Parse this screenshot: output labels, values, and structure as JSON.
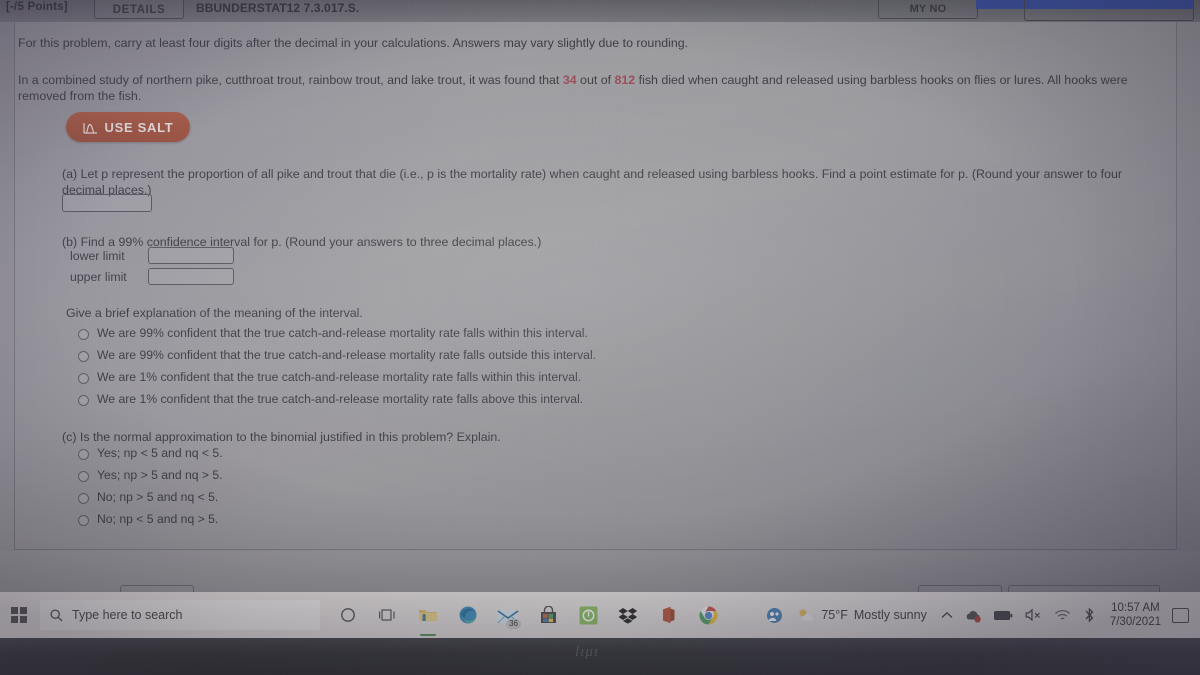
{
  "question_header": {
    "points": "[-/5 Points]",
    "details_button": "DETAILS",
    "title": "BBUNDERSTAT12 7.3.017.S.",
    "my_notes_button": "MY NO"
  },
  "content": {
    "note": "For this problem, carry at least four digits after the decimal in your calculations. Answers may vary slightly due to rounding.",
    "problem_pre": "In a combined study of northern pike, cutthroat trout, rainbow trout, and lake trout, it was found that ",
    "problem_num1": "34",
    "problem_mid": " out of ",
    "problem_num2": "812",
    "problem_post": " fish died when caught and released using barbless hooks on flies or lures. All hooks were removed from the fish.",
    "salt_button": "USE SALT",
    "salt_icon": "distribution-curve-icon",
    "part_a": "(a) Let p represent the proportion of all pike and trout that die (i.e., p is the mortality rate) when caught and released using barbless hooks. Find a point estimate for p. (Round your answer to four decimal places.)",
    "part_a_value": "",
    "part_b": "(b) Find a 99% confidence interval for p. (Round your answers to three decimal places.)",
    "lower_limit_label": "lower limit",
    "upper_limit_label": "upper limit",
    "lower_limit_value": "",
    "upper_limit_value": "",
    "explain_prompt": "Give a brief explanation of the meaning of the interval.",
    "explain_options": [
      "We are 99% confident that the true catch-and-release mortality rate falls within this interval.",
      "We are 99% confident that the true catch-and-release mortality rate falls outside this interval.",
      "We are 1% confident that the true catch-and-release mortality rate falls within this interval.",
      "We are 1% confident that the true catch-and-release mortality rate falls above this interval."
    ],
    "part_c": "(c) Is the normal approximation to the binomial justified in this problem? Explain.",
    "part_c_options": [
      "Yes; np < 5 and nq < 5.",
      "Yes; np > 5 and nq > 5.",
      "No; np > 5 and nq < 5.",
      "No; np < 5 and nq > 5."
    ]
  },
  "taskbar": {
    "start_icon": "windows-start-icon",
    "search_icon": "search-icon",
    "search_placeholder": "Type here to search",
    "cortana_icon": "cortana-circle-icon",
    "taskview_icon": "task-view-icon",
    "apps": [
      {
        "name": "file-explorer-icon",
        "glyph": "folder"
      },
      {
        "name": "microsoft-edge-icon",
        "glyph": "edge"
      },
      {
        "name": "mail-icon",
        "glyph": "mail",
        "badge": "36"
      },
      {
        "name": "microsoft-store-icon",
        "glyph": "store"
      },
      {
        "name": "green-app-icon",
        "glyph": "green"
      },
      {
        "name": "dropbox-icon",
        "glyph": "dropbox"
      },
      {
        "name": "microsoft-office-icon",
        "glyph": "office"
      },
      {
        "name": "google-chrome-icon",
        "glyph": "chrome"
      }
    ],
    "tray": {
      "meet_now_icon": "meet-now-icon",
      "weather_icon": "partly-sunny-icon",
      "weather_temp": "75°F",
      "weather_desc": "Mostly sunny",
      "chevron_icon": "show-hidden-icons-chevron",
      "onedrive_icon": "onedrive-sync-icon",
      "battery_icon": "battery-icon",
      "volume_icon": "volume-muted-icon",
      "network_icon": "wifi-icon",
      "bluetooth_icon": "bluetooth-icon",
      "time": "10:57 AM",
      "date": "7/30/2021",
      "action_center_icon": "action-center-icon"
    }
  },
  "colors": {
    "salt_button": "#c2421d",
    "highlight_blue": "#1d40c4",
    "red_number": "#b2364a"
  }
}
